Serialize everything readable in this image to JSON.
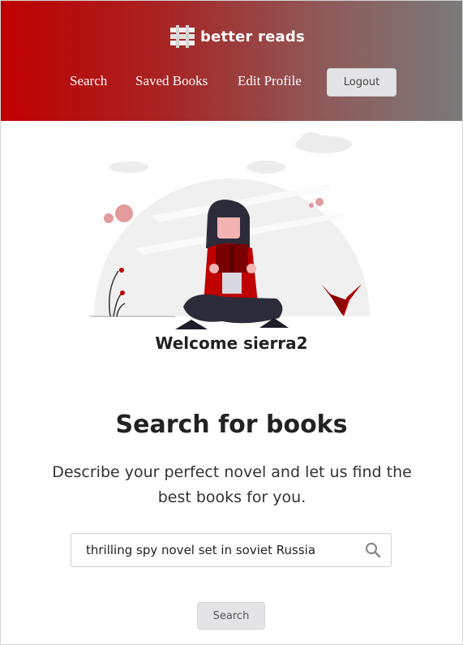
{
  "header": {
    "brand": "better reads",
    "logo_icon": "bookshelf-logo-icon",
    "nav": {
      "search": "Search",
      "saved_books": "Saved Books",
      "edit_profile": "Edit Profile"
    },
    "logout_label": "Logout",
    "gradient_colors": [
      "#c00000",
      "#7a7a7a"
    ]
  },
  "illustration": {
    "icon": "woman-reading-book-illustration"
  },
  "welcome": "Welcome sierra2",
  "main": {
    "heading": "Search for books",
    "subheading": "Describe your perfect novel and let us find the best books for you.",
    "search": {
      "value": "thrilling spy novel set in soviet Russia",
      "icon": "search-icon"
    },
    "search_button_label": "Search"
  },
  "colors": {
    "accent": "#c00000",
    "button_bg": "#e4e4e6"
  }
}
